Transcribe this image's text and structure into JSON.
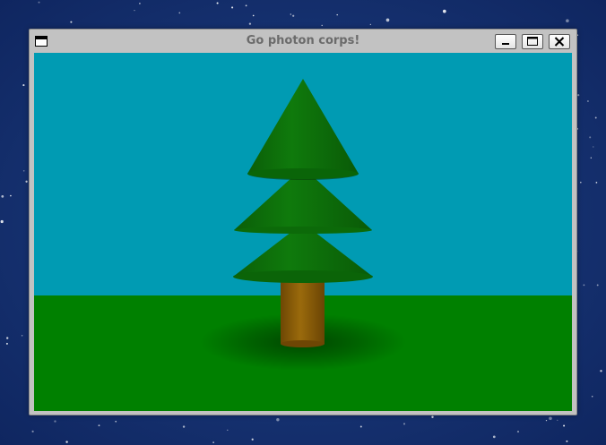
{
  "window": {
    "title": "Go photon corps!"
  },
  "titlebar_buttons": {
    "window_menu_icon": "window-menu-icon",
    "minimize_icon": "minimize-icon",
    "maximize_icon": "maximize-icon",
    "close_icon": "close-icon"
  },
  "scene": {
    "sky_color": "#009bb3",
    "ground_color": "#008000",
    "foliage_color": "#0a6e08",
    "trunk_color": "#8a5a08"
  }
}
